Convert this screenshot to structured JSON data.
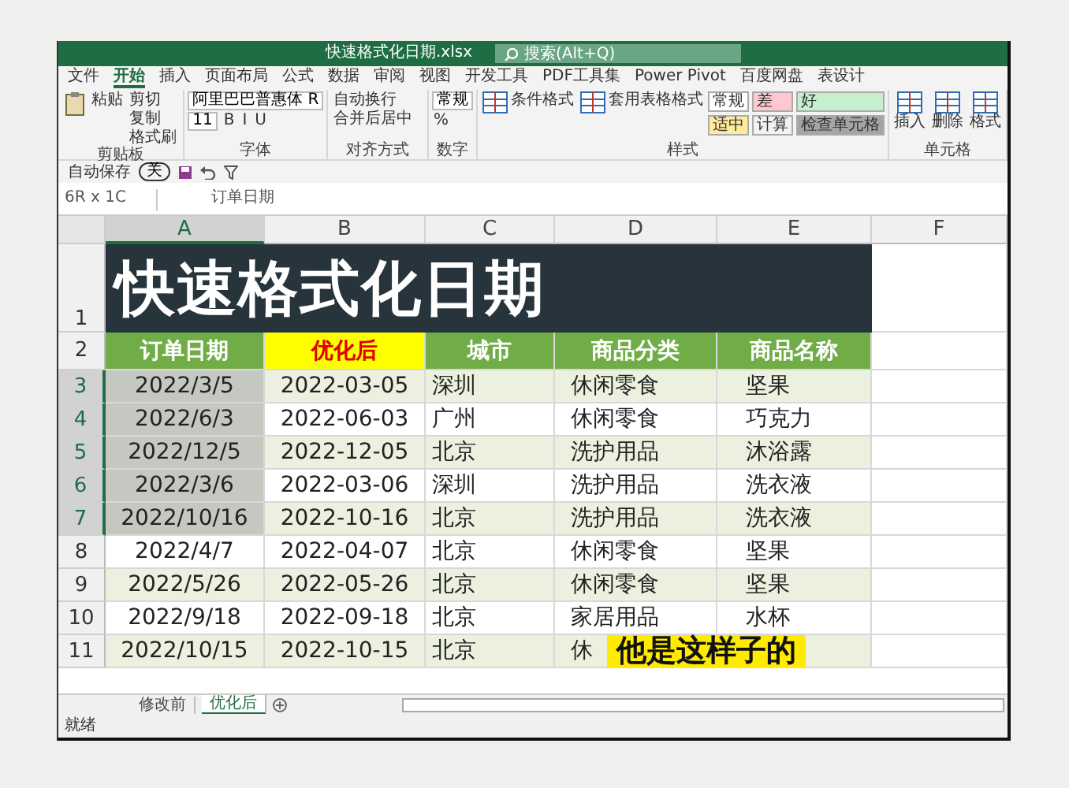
{
  "window": {
    "title": "快速格式化日期.xlsx",
    "search_placeholder": "搜索(Alt+Q)"
  },
  "menu_tabs": [
    {
      "label": "文件",
      "selected": false
    },
    {
      "label": "开始",
      "selected": true
    },
    {
      "label": "插入",
      "selected": false
    },
    {
      "label": "页面布局",
      "selected": false
    },
    {
      "label": "公式",
      "selected": false
    },
    {
      "label": "数据",
      "selected": false
    },
    {
      "label": "审阅",
      "selected": false
    },
    {
      "label": "视图",
      "selected": false
    },
    {
      "label": "开发工具",
      "selected": false
    },
    {
      "label": "PDF工具集",
      "selected": false
    },
    {
      "label": "Power Pivot",
      "selected": false
    },
    {
      "label": "百度网盘",
      "selected": false
    },
    {
      "label": "表设计",
      "selected": false
    }
  ],
  "ribbon": {
    "groups": [
      {
        "label": "剪贴板",
        "items": [
          {
            "kind": "big",
            "label": "粘贴"
          },
          {
            "kind": "small",
            "label": "剪切"
          },
          {
            "kind": "small",
            "label": "复制"
          },
          {
            "kind": "small",
            "label": "格式刷"
          }
        ]
      },
      {
        "label": "字体",
        "items": [
          {
            "kind": "field",
            "label": "阿里巴巴普惠体 R"
          },
          {
            "kind": "field",
            "label": "11"
          },
          {
            "kind": "small",
            "label": "B"
          },
          {
            "kind": "small",
            "label": "I"
          },
          {
            "kind": "small",
            "label": "U"
          }
        ]
      },
      {
        "label": "对齐方式",
        "items": [
          {
            "kind": "small",
            "label": "自动换行"
          },
          {
            "kind": "small",
            "label": "合并后居中"
          }
        ]
      },
      {
        "label": "数字",
        "items": [
          {
            "kind": "field",
            "label": "常规"
          },
          {
            "kind": "small",
            "label": "%"
          }
        ]
      },
      {
        "label": "样式",
        "items": [
          {
            "kind": "big",
            "label": "条件格式"
          },
          {
            "kind": "big",
            "label": "套用表格格式"
          },
          {
            "kind": "style",
            "label": "常规",
            "color": "#ffffff"
          },
          {
            "kind": "style",
            "label": "差",
            "color": "#ffc7ce"
          },
          {
            "kind": "style",
            "label": "好",
            "color": "#c6efce"
          },
          {
            "kind": "style",
            "label": "适中",
            "color": "#ffeb9c"
          },
          {
            "kind": "style",
            "label": "计算",
            "color": "#f2f2f2"
          },
          {
            "kind": "style",
            "label": "检查单元格",
            "color": "#a5a5a5"
          }
        ]
      },
      {
        "label": "单元格",
        "items": [
          {
            "kind": "big",
            "label": "插入"
          },
          {
            "kind": "big",
            "label": "删除"
          },
          {
            "kind": "big",
            "label": "格式"
          }
        ]
      }
    ]
  },
  "quick_access": {
    "autosave": "自动保存",
    "toggle": "关"
  },
  "formula_bar": {
    "name_box": "6R x 1C",
    "value": "订单日期"
  },
  "sheet": {
    "columns": [
      {
        "label": "A",
        "selected": true
      },
      {
        "label": "B",
        "selected": false
      },
      {
        "label": "C",
        "selected": false
      },
      {
        "label": "D",
        "selected": false
      },
      {
        "label": "E",
        "selected": false
      },
      {
        "label": "F",
        "selected": false
      }
    ],
    "rows": [
      {
        "number": "1",
        "kind": "title",
        "selected": false,
        "title": "快速格式化日期"
      },
      {
        "number": "2",
        "kind": "header",
        "selected": false,
        "cells": [
          {
            "text": "订单日期",
            "highlight": false
          },
          {
            "text": "优化后",
            "highlight": true
          },
          {
            "text": "城市",
            "highlight": false
          },
          {
            "text": "商品分类",
            "highlight": false
          },
          {
            "text": "商品名称",
            "highlight": false
          }
        ]
      },
      {
        "number": "3",
        "kind": "data",
        "selected": true,
        "shaded": true,
        "cells": [
          "2022/3/5",
          "2022-03-05",
          "深圳",
          "休闲零食",
          "坚果"
        ]
      },
      {
        "number": "4",
        "kind": "data",
        "selected": true,
        "shaded": false,
        "cells": [
          "2022/6/3",
          "2022-06-03",
          "广州",
          "休闲零食",
          "巧克力"
        ]
      },
      {
        "number": "5",
        "kind": "data",
        "selected": true,
        "shaded": true,
        "cells": [
          "2022/12/5",
          "2022-12-05",
          "北京",
          "洗护用品",
          "沐浴露"
        ]
      },
      {
        "number": "6",
        "kind": "data",
        "selected": true,
        "shaded": false,
        "cells": [
          "2022/3/6",
          "2022-03-06",
          "深圳",
          "洗护用品",
          "洗衣液"
        ]
      },
      {
        "number": "7",
        "kind": "data",
        "selected": true,
        "shaded": true,
        "cells": [
          "2022/10/16",
          "2022-10-16",
          "北京",
          "洗护用品",
          "洗衣液"
        ]
      },
      {
        "number": "8",
        "kind": "data",
        "selected": false,
        "shaded": false,
        "cells": [
          "2022/4/7",
          "2022-04-07",
          "北京",
          "休闲零食",
          "坚果"
        ]
      },
      {
        "number": "9",
        "kind": "data",
        "selected": false,
        "shaded": true,
        "cells": [
          "2022/5/26",
          "2022-05-26",
          "北京",
          "休闲零食",
          "坚果"
        ]
      },
      {
        "number": "10",
        "kind": "data",
        "selected": false,
        "shaded": false,
        "cells": [
          "2022/9/18",
          "2022-09-18",
          "北京",
          "家居用品",
          "水杯"
        ]
      },
      {
        "number": "11",
        "kind": "data",
        "selected": false,
        "shaded": true,
        "cells": [
          "2022/10/15",
          "2022-10-15",
          "北京",
          "休"
        ]
      }
    ]
  },
  "caption": "他是这样子的",
  "sheet_tabs": [
    {
      "label": "修改前",
      "selected": false
    },
    {
      "label": "优化后",
      "selected": true
    }
  ],
  "status": "就绪"
}
